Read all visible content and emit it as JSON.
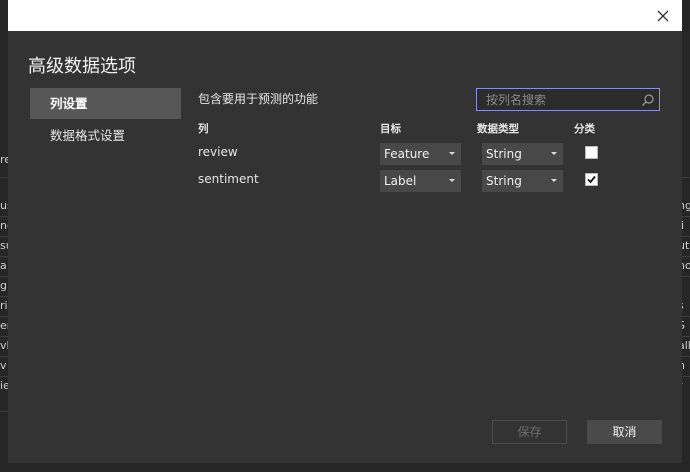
{
  "dialog": {
    "title": "高级数据选项",
    "close_icon": "close-icon"
  },
  "sidebar": {
    "items": [
      {
        "label": "列设置",
        "active": true
      },
      {
        "label": "数据格式设置",
        "active": false
      }
    ]
  },
  "main": {
    "section_label": "包含要用于预测的功能",
    "search": {
      "placeholder": "按列名搜索",
      "value": "",
      "icon": "search-icon"
    },
    "headers": {
      "column": "列",
      "target": "目标",
      "data_type": "数据类型",
      "category": "分类"
    },
    "rows": [
      {
        "name": "review",
        "target": "Feature",
        "data_type": "String",
        "category": false
      },
      {
        "name": "sentiment",
        "target": "Label",
        "data_type": "String",
        "category": true
      }
    ]
  },
  "footer": {
    "save_label": "保存",
    "save_enabled": false,
    "cancel_label": "取消"
  },
  "background": {
    "left_fragments": [
      "re",
      "us",
      "ne",
      "su",
      "a",
      "g",
      "ri",
      "er",
      "vh",
      "v",
      "ie"
    ],
    "right_fragments": [
      "ng",
      "li",
      "ut",
      "no",
      "s",
      "S",
      "all",
      "n",
      "r"
    ]
  },
  "colors": {
    "dialog_bg": "#333333",
    "sidebar_active": "#575757",
    "search_border": "#8a8fd6",
    "dropdown_bg": "#484848"
  }
}
